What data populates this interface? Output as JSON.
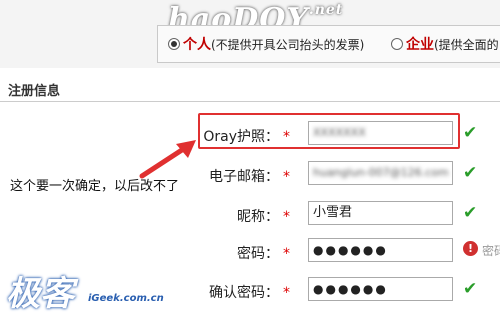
{
  "watermark_top": "haoDOY",
  "watermark_top_suffix": ".net",
  "account_type": {
    "options": [
      {
        "label": "个人",
        "note": "(不提供开具公司抬头的发票)",
        "selected": true
      },
      {
        "label": "企业",
        "note": "(提供全面的",
        "selected": false
      }
    ]
  },
  "section_title": "注册信息",
  "annotation": "这个要一次确定，以后改不了",
  "required_mark": "*",
  "form": {
    "oray_label": "Oray护照：",
    "oray_value": "XXXXXXX",
    "email_label": "电子邮箱：",
    "email_value": "huanglun-007@126.com",
    "nickname_label": "昵称：",
    "nickname_value": "小雪君",
    "password_label": "密码：",
    "password_value": "●●●●●●",
    "password_hint": "密码",
    "confirm_label": "确认密码：",
    "confirm_value": "●●●●●●"
  },
  "icons": {
    "check": "✔",
    "warn": "!"
  },
  "logo_bottom": "极客",
  "logo_url": "iGeek.com.cn",
  "colors": {
    "highlight": "#e03030",
    "ok": "#2a9d2a",
    "required": "#d00000",
    "selected_option": "#c00000"
  }
}
